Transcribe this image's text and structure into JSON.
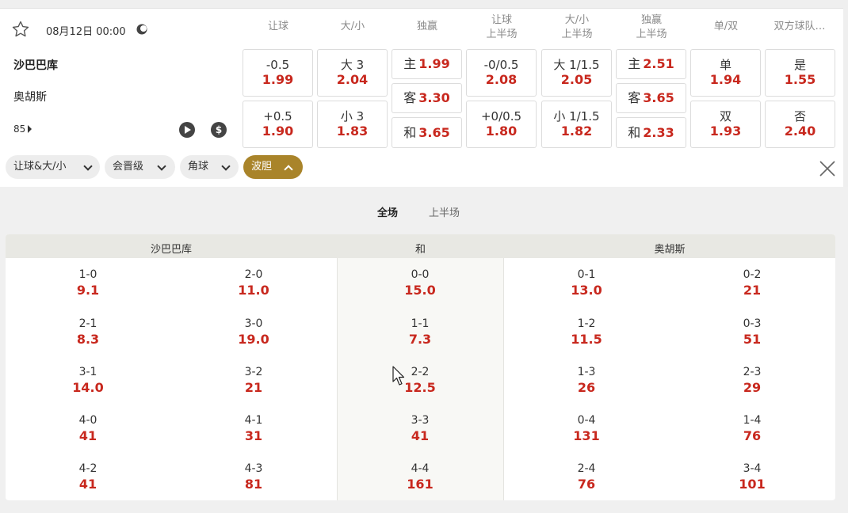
{
  "match": {
    "datetime": "08月12日 00:00",
    "home": "沙巴巴库",
    "away": "奥胡斯",
    "minute": "85"
  },
  "columns": [
    {
      "line1": "让球",
      "line2": ""
    },
    {
      "line1": "大/小",
      "line2": ""
    },
    {
      "line1": "独赢",
      "line2": ""
    },
    {
      "line1": "让球",
      "line2": "上半场"
    },
    {
      "line1": "大/小",
      "line2": "上半场"
    },
    {
      "line1": "独赢",
      "line2": "上半场"
    },
    {
      "line1": "单/双",
      "line2": ""
    },
    {
      "line1": "双方球队…",
      "line2": ""
    }
  ],
  "odds": {
    "hdp": [
      {
        "label": "-0.5",
        "value": "1.99"
      },
      {
        "label": "+0.5",
        "value": "1.90"
      }
    ],
    "ou": [
      {
        "label": "大 3",
        "value": "2.04"
      },
      {
        "label": "小 3",
        "value": "1.83"
      }
    ],
    "x12": [
      {
        "label": "主",
        "value": "1.99"
      },
      {
        "label": "客",
        "value": "3.30"
      },
      {
        "label": "和",
        "value": "3.65"
      }
    ],
    "hdp_h1": [
      {
        "label": "-0/0.5",
        "value": "2.08"
      },
      {
        "label": "+0/0.5",
        "value": "1.80"
      }
    ],
    "ou_h1": [
      {
        "label": "大 1/1.5",
        "value": "2.05"
      },
      {
        "label": "小 1/1.5",
        "value": "1.82"
      }
    ],
    "x12_h1": [
      {
        "label": "主",
        "value": "2.51"
      },
      {
        "label": "客",
        "value": "3.65"
      },
      {
        "label": "和",
        "value": "2.33"
      }
    ],
    "oe": [
      {
        "label": "单",
        "value": "1.94"
      },
      {
        "label": "双",
        "value": "1.93"
      }
    ],
    "btts": [
      {
        "label": "是",
        "value": "1.55"
      },
      {
        "label": "否",
        "value": "2.40"
      }
    ]
  },
  "filters": [
    {
      "label": "让球&大/小",
      "active": false
    },
    {
      "label": "会晋级",
      "active": false
    },
    {
      "label": "角球",
      "active": false
    },
    {
      "label": "波胆",
      "active": true
    }
  ],
  "tabs": [
    "全场",
    "上半场"
  ],
  "score_headers": {
    "home": "沙巴巴库",
    "draw": "和",
    "away": "奥胡斯"
  },
  "scores": [
    [
      {
        "s": "1-0",
        "o": "9.1"
      },
      {
        "s": "2-0",
        "o": "11.0"
      },
      {
        "s": "0-0",
        "o": "15.0"
      },
      {
        "s": "0-1",
        "o": "13.0"
      },
      {
        "s": "0-2",
        "o": "21"
      }
    ],
    [
      {
        "s": "2-1",
        "o": "8.3"
      },
      {
        "s": "3-0",
        "o": "19.0"
      },
      {
        "s": "1-1",
        "o": "7.3"
      },
      {
        "s": "1-2",
        "o": "11.5"
      },
      {
        "s": "0-3",
        "o": "51"
      }
    ],
    [
      {
        "s": "3-1",
        "o": "14.0"
      },
      {
        "s": "3-2",
        "o": "21"
      },
      {
        "s": "2-2",
        "o": "12.5"
      },
      {
        "s": "1-3",
        "o": "26"
      },
      {
        "s": "2-3",
        "o": "29"
      }
    ],
    [
      {
        "s": "4-0",
        "o": "41"
      },
      {
        "s": "4-1",
        "o": "31"
      },
      {
        "s": "3-3",
        "o": "41"
      },
      {
        "s": "0-4",
        "o": "131"
      },
      {
        "s": "1-4",
        "o": "76"
      }
    ],
    [
      {
        "s": "4-2",
        "o": "41"
      },
      {
        "s": "4-3",
        "o": "81"
      },
      {
        "s": "4-4",
        "o": "161"
      },
      {
        "s": "2-4",
        "o": "76"
      },
      {
        "s": "3-4",
        "o": "101"
      }
    ]
  ],
  "colors": {
    "odds_red": "#c8281e",
    "accent_gold": "#a9842a"
  }
}
